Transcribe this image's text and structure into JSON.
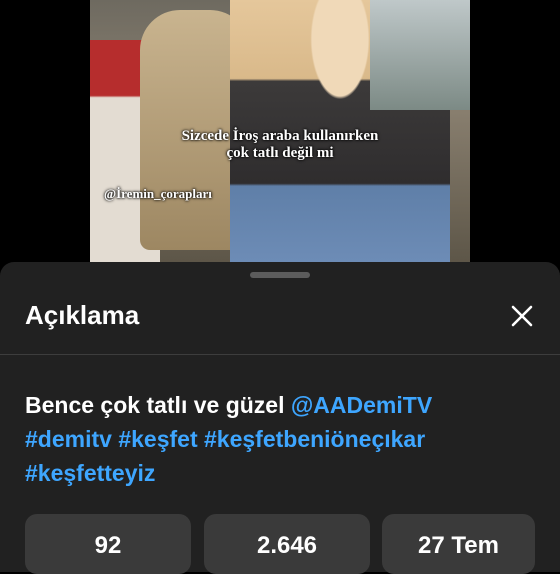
{
  "video": {
    "caption_line1": "Sizcede İroş araba kullanırken",
    "caption_line2": "çok tatlı değil mi",
    "watermark": "@İremin_çorapları"
  },
  "sheet": {
    "title": "Açıklama",
    "close_icon": "close-icon",
    "description": {
      "text": "Bence çok tatlı ve güzel ",
      "mention": "@AADemiTV",
      "hashtags": [
        "#demitv",
        "#keşfet",
        "#keşfetbeniöneçıkar",
        "#keşfetteyiz"
      ]
    },
    "stats": {
      "likes": "92",
      "views": "2.646",
      "date": "27 Tem"
    }
  },
  "colors": {
    "sheet_bg": "#212121",
    "link": "#3ea6ff",
    "stat_bg": "#3a3a3a"
  }
}
